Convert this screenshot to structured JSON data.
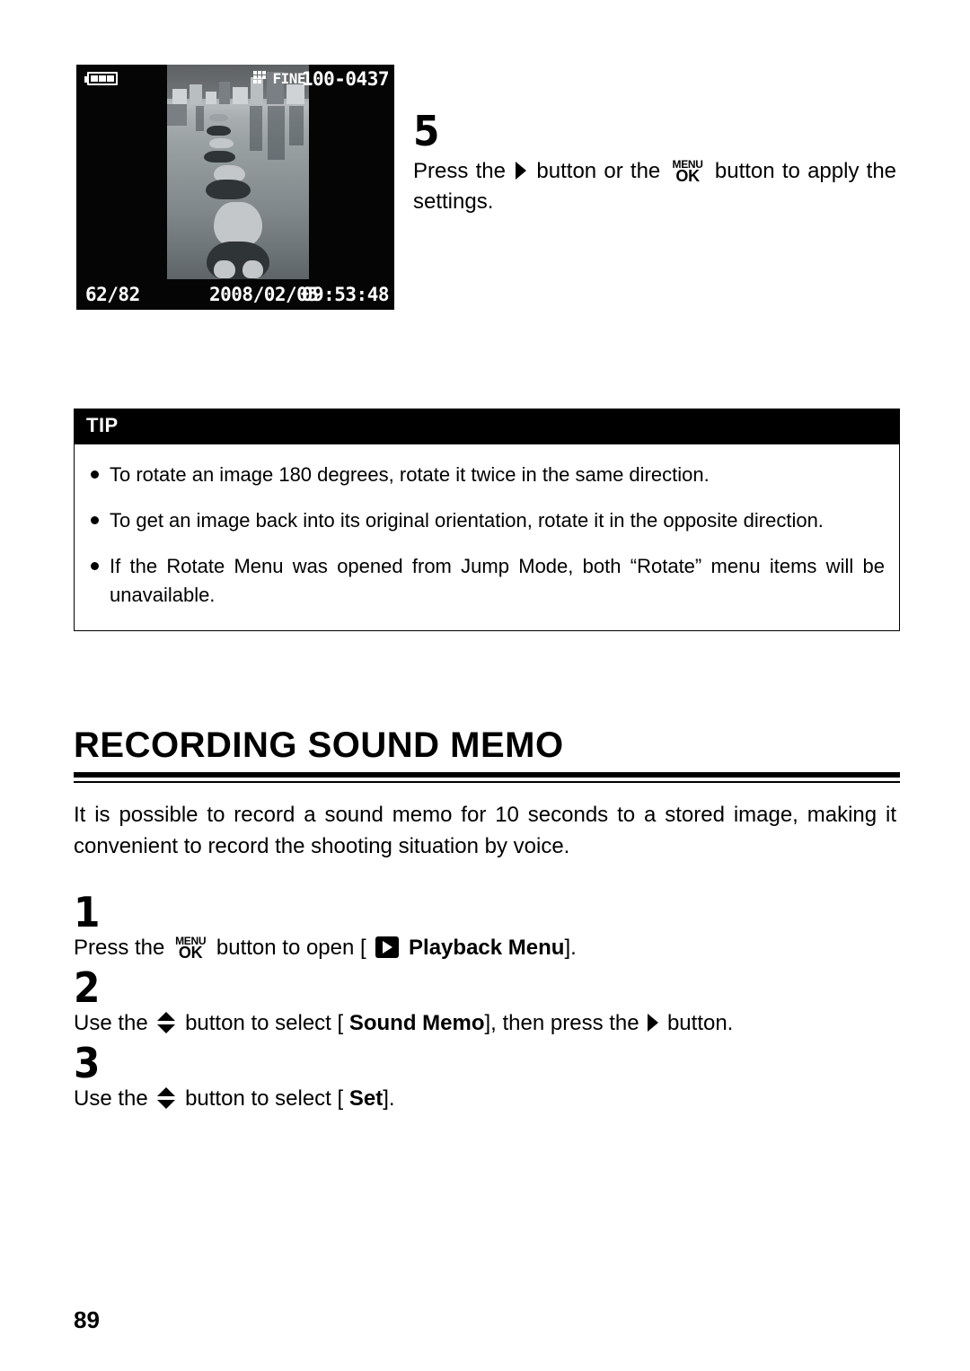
{
  "page_number": "89",
  "camera_lcd": {
    "battery_icon": "battery-full-icon",
    "quality_icon": "image-quality-icon",
    "quality_label": "FINE",
    "file_number": "100-0437",
    "frame_counter": "62/82",
    "date": "2008/02/05",
    "time": "09:53:48"
  },
  "step5": {
    "number": "5",
    "text_part1": "Press the",
    "right_button_icon": "right-arrow-button-icon",
    "text_part2": "button or the",
    "menu_ok_icon": "menu-ok-button-icon",
    "menu_ok_top": "MENU",
    "menu_ok_bottom": "OK",
    "text_part3": "button to apply the settings."
  },
  "tip": {
    "header": "TIP",
    "items": [
      "To rotate an image 180 degrees, rotate it twice in the same direction.",
      "To get an image back into its original orientation, rotate it in the opposite direction.",
      "If the Rotate Menu was opened from Jump Mode, both “Rotate” menu items will be unavailable."
    ]
  },
  "section": {
    "title": "RECORDING SOUND MEMO",
    "intro": "It is possible to record a sound memo for 10 seconds to a stored image, making it convenient to record the shooting situation by voice."
  },
  "steps": [
    {
      "number": "1",
      "pre": "Press the",
      "icon": "menu-ok-button-icon",
      "menu_ok_top": "MENU",
      "menu_ok_bottom": "OK",
      "mid": "button to open [",
      "playback_icon": "playback-menu-icon",
      "bold": "Playback Menu",
      "post": "]."
    },
    {
      "number": "2",
      "pre": "Use the",
      "icon": "up-down-button-icon",
      "mid": "button to select [",
      "bold": "Sound Memo",
      "mid2": "], then press the",
      "icon2": "right-arrow-button-icon",
      "post": "button."
    },
    {
      "number": "3",
      "pre": "Use the",
      "icon": "up-down-button-icon",
      "mid": "button to select [",
      "bold": "Set",
      "post": "]."
    }
  ],
  "colors": {
    "ink": "#000000",
    "paper": "#ffffff",
    "lcd_background": "#050505",
    "lcd_text": "#ffffff"
  }
}
